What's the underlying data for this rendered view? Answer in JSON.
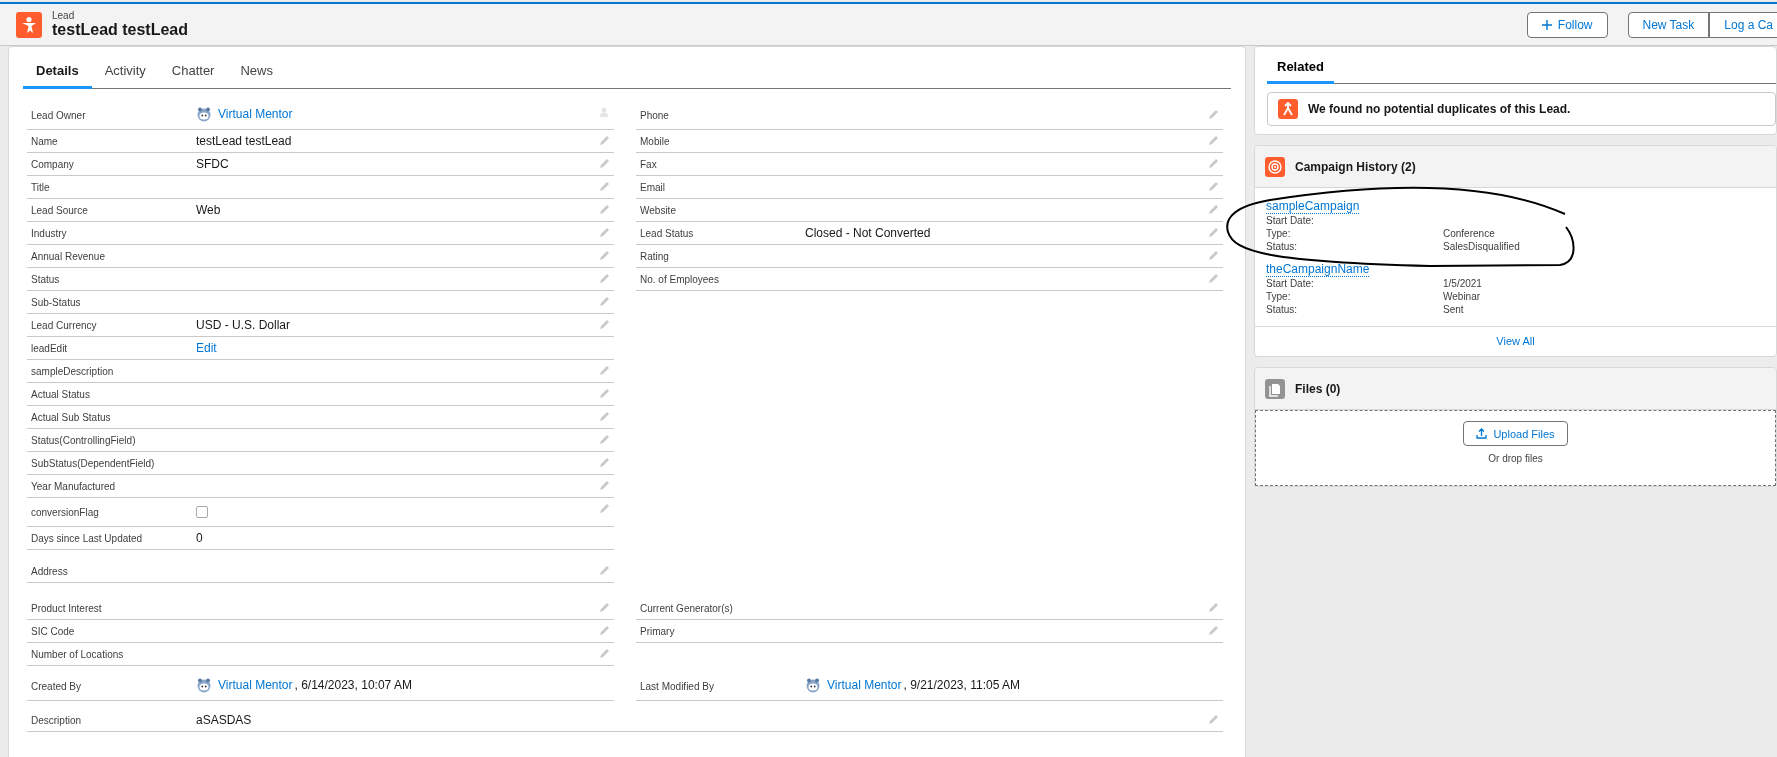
{
  "header": {
    "object_type": "Lead",
    "title": "testLead testLead",
    "actions": [
      {
        "label": "Follow",
        "kind": "follow"
      },
      {
        "label": "New Task",
        "kind": "group"
      },
      {
        "label": "Log a Ca",
        "kind": "group"
      }
    ]
  },
  "tabs": [
    {
      "label": "Details",
      "selected": true
    },
    {
      "label": "Activity",
      "selected": false
    },
    {
      "label": "Chatter",
      "selected": false
    },
    {
      "label": "News",
      "selected": false
    }
  ],
  "sections": [
    {
      "rows": [
        [
          {
            "label": "Lead Owner",
            "kind": "user",
            "value": "Virtual Mentor",
            "change_owner": true
          },
          {
            "label": "Phone",
            "kind": "text",
            "editable": true
          }
        ],
        [
          {
            "label": "Name",
            "kind": "text",
            "value": "testLead testLead",
            "editable": true
          },
          {
            "label": "Mobile",
            "kind": "text",
            "editable": true
          }
        ],
        [
          {
            "label": "Company",
            "kind": "text",
            "value": "SFDC",
            "editable": true
          },
          {
            "label": "Fax",
            "kind": "text",
            "editable": true
          }
        ],
        [
          {
            "label": "Title",
            "kind": "text",
            "editable": true
          },
          {
            "label": "Email",
            "kind": "text",
            "editable": true
          }
        ],
        [
          {
            "label": "Lead Source",
            "kind": "text",
            "value": "Web",
            "editable": true
          },
          {
            "label": "Website",
            "kind": "text",
            "editable": true
          }
        ],
        [
          {
            "label": "Industry",
            "kind": "text",
            "editable": true
          },
          {
            "label": "Lead Status",
            "kind": "text",
            "value": "Closed - Not Converted",
            "editable": true
          }
        ],
        [
          {
            "label": "Annual Revenue",
            "kind": "text",
            "editable": true
          },
          {
            "label": "Rating",
            "kind": "text",
            "editable": true
          }
        ],
        [
          {
            "label": "Status",
            "kind": "text",
            "editable": true
          },
          {
            "label": "No. of Employees",
            "kind": "text",
            "editable": true
          }
        ],
        [
          {
            "label": "Sub-Status",
            "kind": "text",
            "editable": true
          },
          null
        ],
        [
          {
            "label": "Lead Currency",
            "kind": "text",
            "value": "USD - U.S. Dollar",
            "editable": true
          },
          null
        ],
        [
          {
            "label": "leadEdit",
            "kind": "link",
            "value": "Edit",
            "editable": false
          },
          null
        ],
        [
          {
            "label": "sampleDescription",
            "kind": "text",
            "editable": true
          },
          null
        ],
        [
          {
            "label": "Actual Status",
            "kind": "text",
            "editable": true
          },
          null
        ],
        [
          {
            "label": "Actual Sub Status",
            "kind": "text",
            "editable": true
          },
          null
        ],
        [
          {
            "label": "Status(ControllingField)",
            "kind": "text",
            "editable": true
          },
          null
        ],
        [
          {
            "label": "SubStatus(DependentField)",
            "kind": "text",
            "editable": true
          },
          null
        ],
        [
          {
            "label": "Year Manufactured",
            "kind": "text",
            "editable": true
          },
          null
        ],
        [
          {
            "label": "conversionFlag",
            "kind": "checkbox",
            "checked": false,
            "editable": true
          },
          null
        ],
        [
          {
            "label": "Days since Last Updated",
            "kind": "text",
            "value": "0",
            "editable": false
          },
          null
        ]
      ]
    },
    {
      "rows": [
        [
          {
            "label": "Address",
            "kind": "text",
            "editable": true
          },
          null
        ]
      ]
    },
    {
      "rows": [
        [
          {
            "label": "Product Interest",
            "kind": "text",
            "editable": true
          },
          {
            "label": "Current Generator(s)",
            "kind": "text",
            "editable": true
          }
        ],
        [
          {
            "label": "SIC Code",
            "kind": "text",
            "editable": true
          },
          {
            "label": "Primary",
            "kind": "text",
            "editable": true
          }
        ],
        [
          {
            "label": "Number of Locations",
            "kind": "text",
            "editable": true
          },
          null
        ]
      ]
    },
    {
      "rows": [
        [
          {
            "label": "Created By",
            "kind": "user",
            "value": "Virtual Mentor",
            "detail": ", 6/14/2023, 10:07 AM",
            "editable": false
          },
          {
            "label": "Last Modified By",
            "kind": "user",
            "value": "Virtual Mentor",
            "detail": ", 9/21/2023, 11:05 AM",
            "editable": false
          }
        ]
      ]
    },
    {
      "rows": [
        [
          {
            "label": "Description",
            "kind": "text",
            "value": "aSASDAS",
            "editable": true
          }
        ]
      ]
    }
  ],
  "related": {
    "tab": {
      "label": "Related",
      "selected": true
    },
    "duplicates": "We found no potential duplicates of this Lead.",
    "campaign_history": {
      "title": "Campaign History (2)",
      "items": [
        {
          "name": "sampleCampaign",
          "fields": [
            {
              "label": "Start Date:"
            },
            {
              "label": "Type:",
              "value": "Conference"
            },
            {
              "label": "Status:",
              "value": "SalesDisqualified"
            }
          ]
        },
        {
          "name": "theCampaignName",
          "fields": [
            {
              "label": "Start Date:",
              "value": "1/5/2021"
            },
            {
              "label": "Type:",
              "value": "Webinar"
            },
            {
              "label": "Status:",
              "value": "Sent"
            }
          ]
        }
      ],
      "footer": "View All"
    },
    "files": {
      "title": "Files (0)",
      "button": "Upload Files",
      "hint": "Or drop files"
    }
  }
}
